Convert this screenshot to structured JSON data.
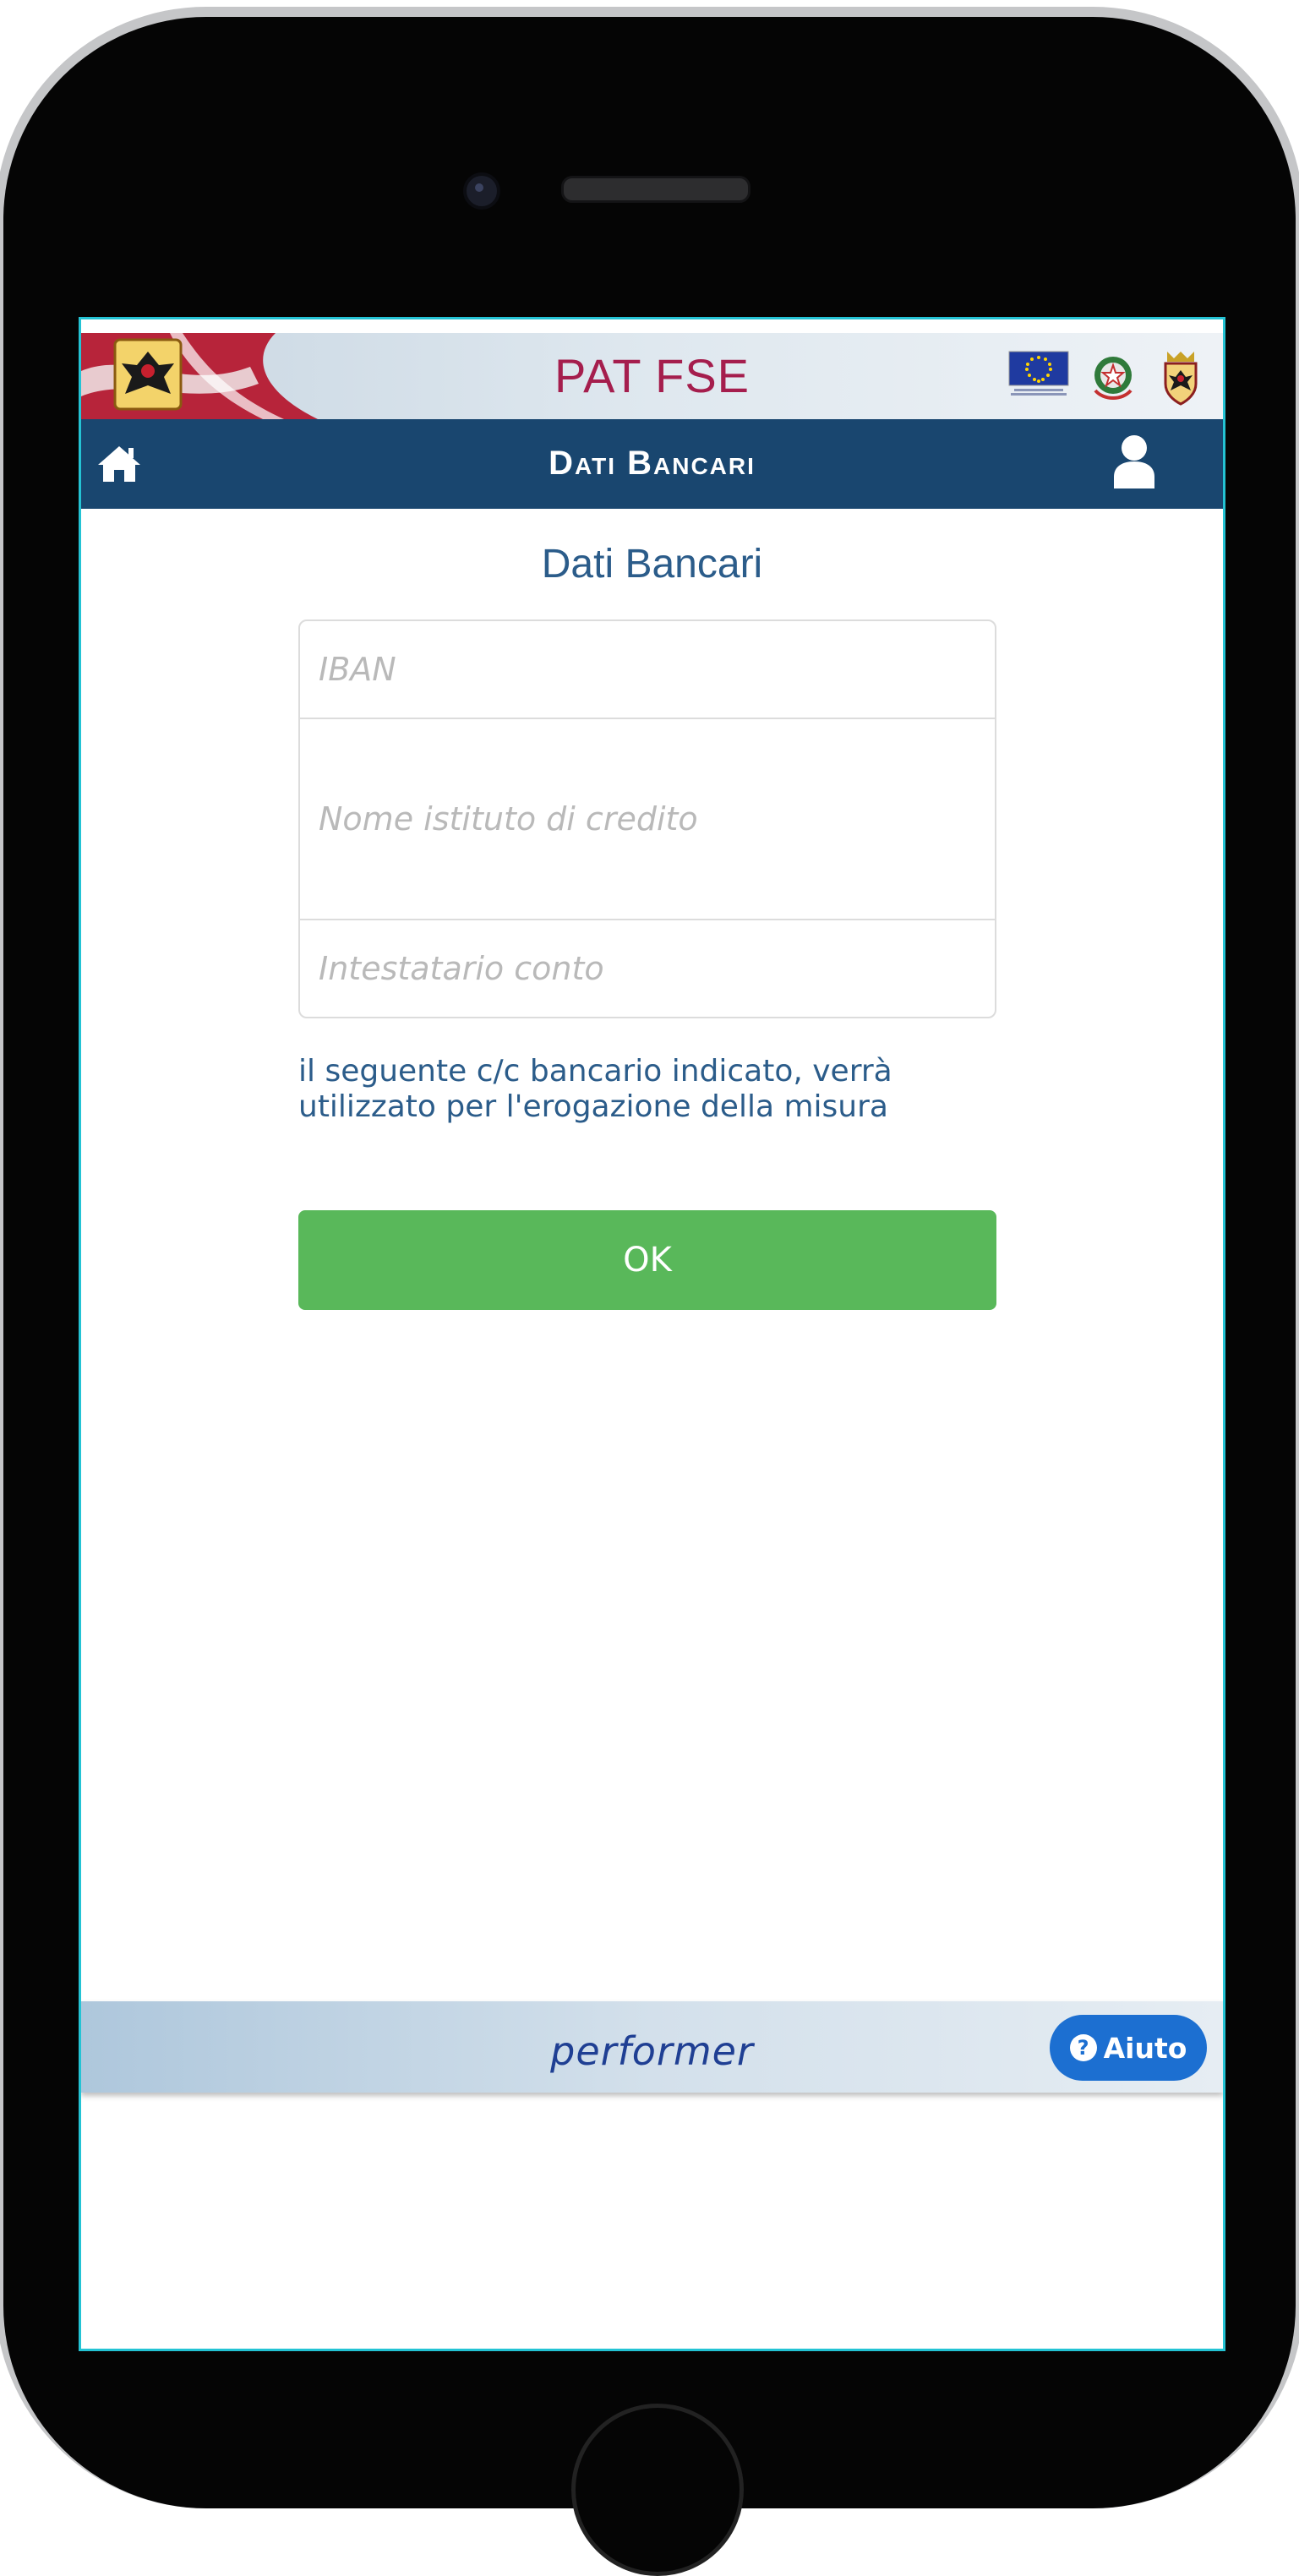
{
  "header": {
    "app_title": "PAT FSE"
  },
  "navbar": {
    "title": "Dati Bancari",
    "home_icon": "home-icon",
    "user_icon": "user-icon"
  },
  "content": {
    "title": "Dati Bancari",
    "fields": {
      "iban_placeholder": "IBAN",
      "iban_value": "",
      "bank_placeholder": "Nome istituto di credito",
      "bank_value": "",
      "holder_placeholder": "Intestatario conto",
      "holder_value": ""
    },
    "info_line1": "il seguente c/c bancario indicato, verrà",
    "info_line2": "utilizzato per l'erogazione della misura",
    "ok_label": "OK"
  },
  "footer": {
    "brand": "performer",
    "help_label": "Aiuto",
    "help_icon_glyph": "?"
  },
  "colors": {
    "title_red": "#a51e4d",
    "navbar_blue": "#19466f",
    "text_blue": "#2b5c8a",
    "ok_green": "#59b85a",
    "help_blue": "#1c6fd1"
  }
}
